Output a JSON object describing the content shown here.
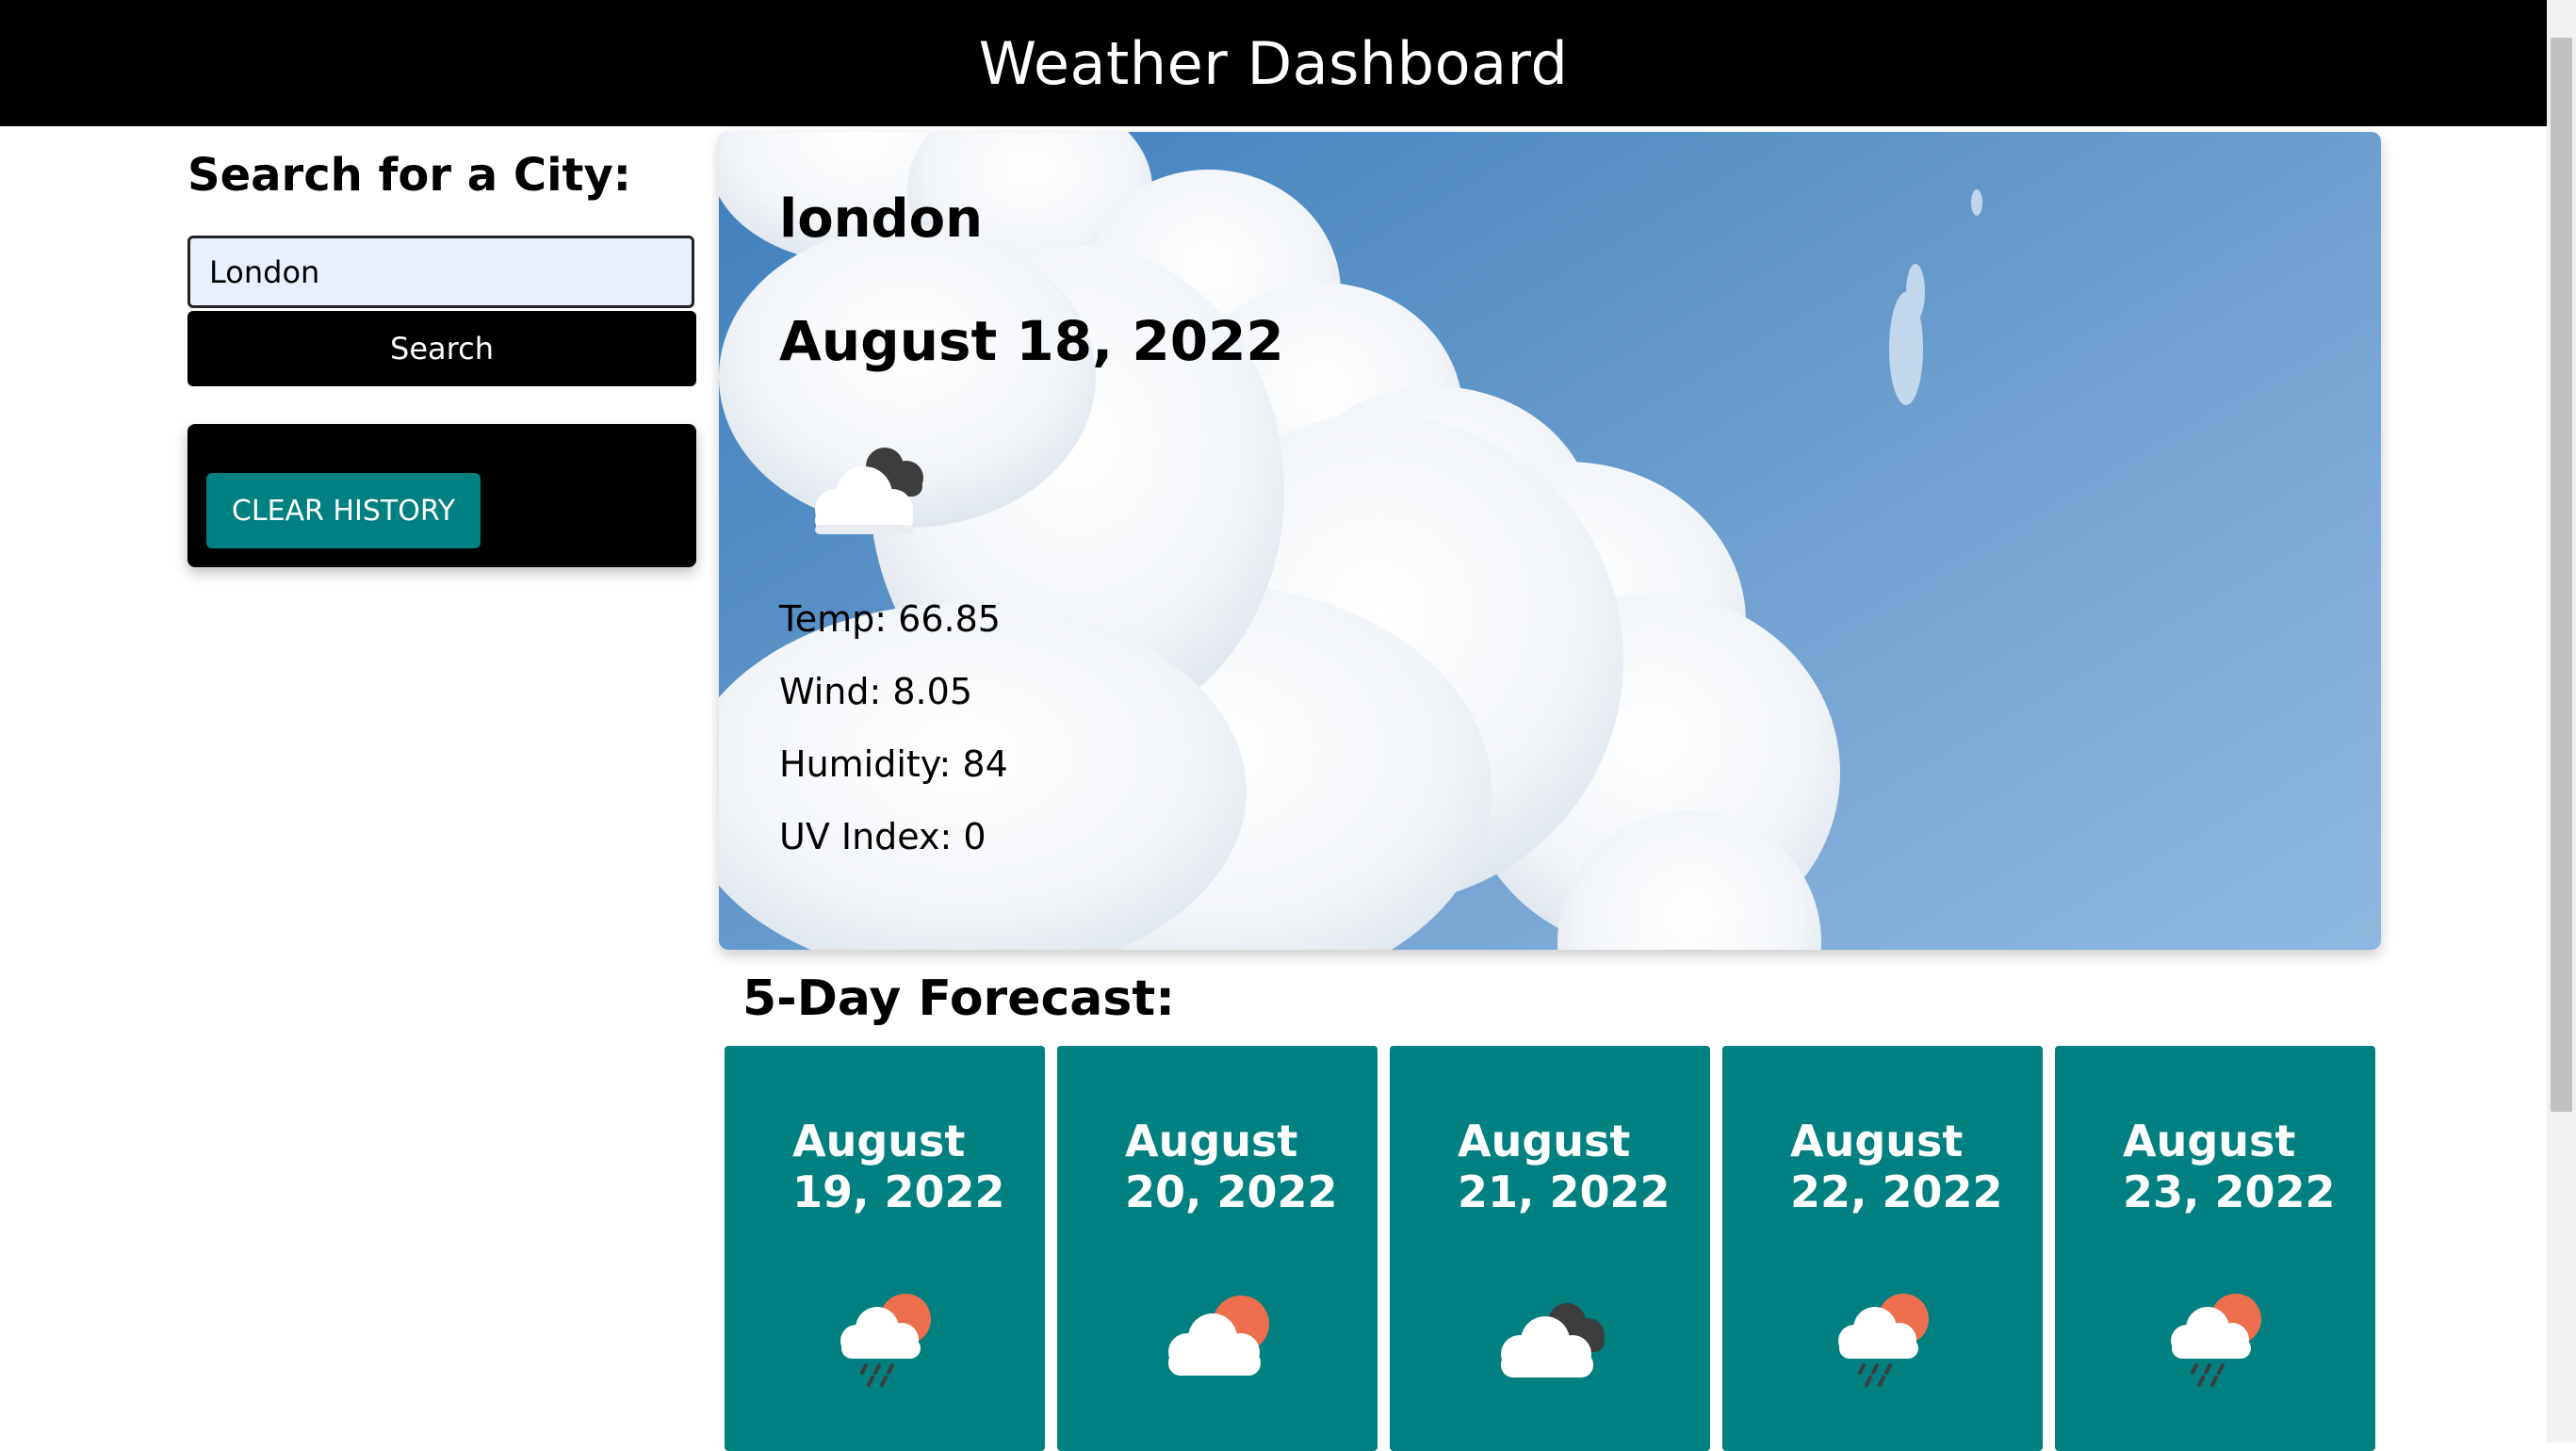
{
  "header": {
    "title": "Weather Dashboard"
  },
  "search": {
    "title": "Search for a City:",
    "input_value": "London",
    "button_label": "Search",
    "clear_label": "CLEAR HISTORY"
  },
  "current": {
    "city": "london",
    "date": "August 18, 2022",
    "icon": "cloud-partly-dark-icon",
    "temp": "Temp: 66.85",
    "wind": "Wind: 8.05",
    "humidity": "Humidity: 84",
    "uv": "UV Index: 0"
  },
  "forecast": {
    "title": "5-Day Forecast:",
    "days": [
      {
        "date": "August 19, 2022",
        "icon": "rain-sun-icon"
      },
      {
        "date": "August 20, 2022",
        "icon": "cloud-sun-icon"
      },
      {
        "date": "August 21, 2022",
        "icon": "cloud-dark-icon"
      },
      {
        "date": "August 22, 2022",
        "icon": "rain-sun-icon"
      },
      {
        "date": "August 23, 2022",
        "icon": "rain-sun-icon"
      }
    ]
  },
  "colors": {
    "header_bg": "#000000",
    "accent": "#008080",
    "sky": "#5b93c8",
    "input_bg": "#e8f0fe"
  }
}
